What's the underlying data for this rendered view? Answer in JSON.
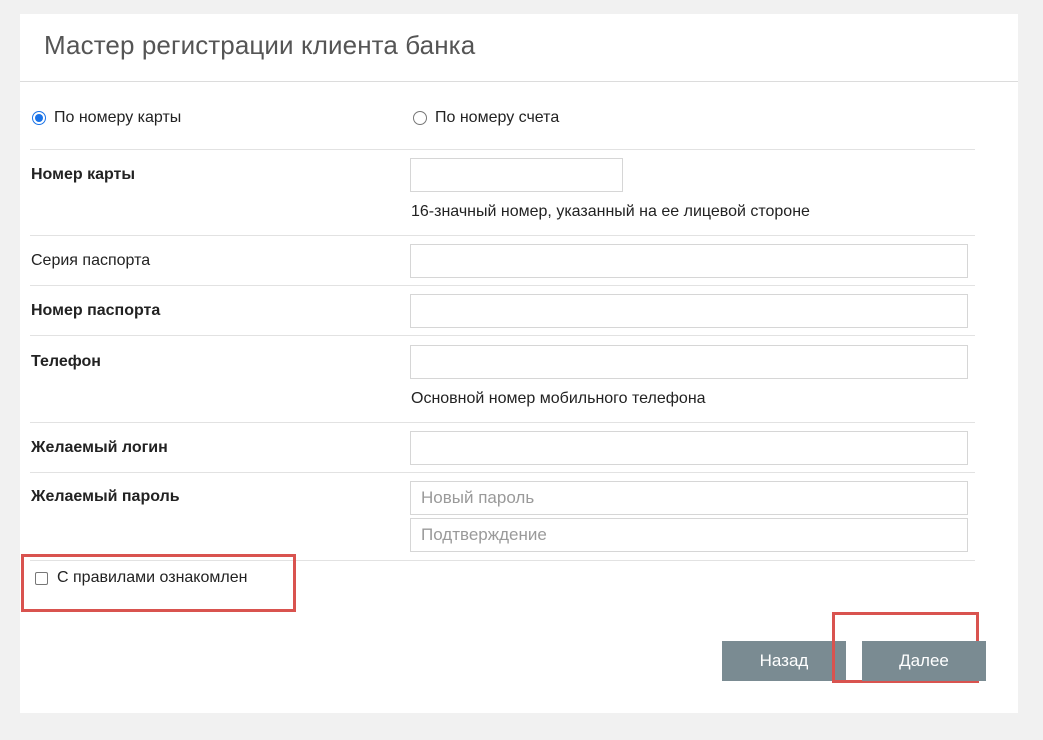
{
  "header": {
    "title": "Мастер регистрации клиента банка"
  },
  "mode": {
    "options": [
      {
        "label": "По номеру карты",
        "checked": true
      },
      {
        "label": "По номеру счета",
        "checked": false
      }
    ]
  },
  "fields": {
    "card_number": {
      "label": "Номер карты",
      "hint": "16-значный номер, указанный на ее лицевой стороне",
      "value": ""
    },
    "passport_series": {
      "label": "Серия паспорта",
      "value": ""
    },
    "passport_number": {
      "label": "Номер паспорта",
      "value": ""
    },
    "phone": {
      "label": "Телефон",
      "hint": "Основной номер мобильного телефона",
      "value": ""
    },
    "login": {
      "label": "Желаемый логин",
      "value": ""
    },
    "password": {
      "label": "Желаемый пароль",
      "new_placeholder": "Новый пароль",
      "confirm_placeholder": "Подтверждение"
    }
  },
  "agreement": {
    "label": "С правилами ознакомлен",
    "checked": false
  },
  "buttons": {
    "back": "Назад",
    "next": "Далее"
  },
  "colors": {
    "accent_radio": "#1a73e8",
    "button_bg": "#7a8b92",
    "highlight_border": "#d9534f"
  }
}
